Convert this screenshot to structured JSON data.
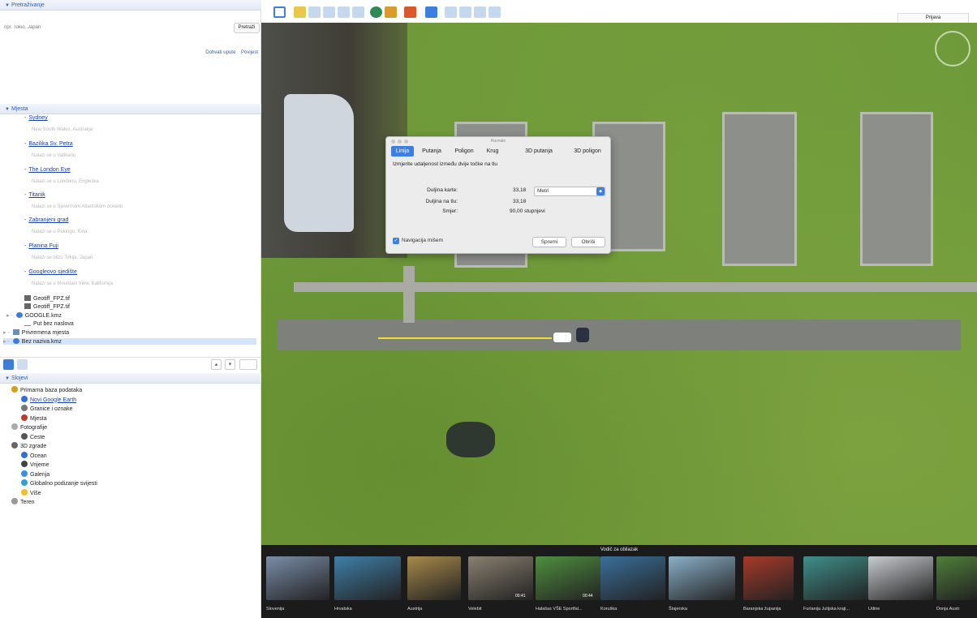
{
  "search": {
    "header": "Pretraživanje",
    "placeholder": "npr. Tokio, Japan",
    "button": "Pretraži",
    "links": [
      "Dohvati upute",
      "Povijest"
    ]
  },
  "places": {
    "header": "Mjesta",
    "items": [
      {
        "title": "Sydney",
        "subtitle": "New South Wales, Australija"
      },
      {
        "title": "Bazilika Sv. Petra",
        "subtitle": "Nalazi se u Vatikanu"
      },
      {
        "title": "The London Eye",
        "subtitle": "Nalazi se u Londonu, Engleska"
      },
      {
        "title": "Titanik",
        "subtitle": "Nalazi se u Sjevernom Atlantskom oceanu"
      },
      {
        "title": "Zabranjeni grad",
        "subtitle": "Nalazi se u Pekingu, Kina"
      },
      {
        "title": "Planina Fuji",
        "subtitle": "Nalazi se blizu Tokija, Japan"
      },
      {
        "title": "Googleovo sjedište",
        "subtitle": "Nalazi se u Mountain View, Kalifornija"
      }
    ],
    "files": [
      "Geotiff_FPZ.tif",
      "Geotiff_FPZ.tif",
      "GOOGLE.kmz",
      "Put bez naslova",
      "Privremena mjesta",
      "Bez naziva.kmz"
    ]
  },
  "layers": {
    "header": "Slojevi",
    "items": [
      {
        "label": "Primarna baza podataka",
        "color": "#d4a017"
      },
      {
        "label": "Novi Google Earth",
        "color": "#2f6fd8",
        "link": true
      },
      {
        "label": "Granice i oznake",
        "color": "#777777"
      },
      {
        "label": "Mjesta",
        "color": "#c0392b"
      },
      {
        "label": "Fotografije",
        "color": "#aaaaaa"
      },
      {
        "label": "Ceste",
        "color": "#555555"
      },
      {
        "label": "3D zgrade",
        "color": "#666666"
      },
      {
        "label": "Ocean",
        "color": "#2f6fd8"
      },
      {
        "label": "Vrijeme",
        "color": "#444444"
      },
      {
        "label": "Galerija",
        "color": "#3a8ee6"
      },
      {
        "label": "Globalno podizanje svijesti",
        "color": "#2f9fd8"
      },
      {
        "label": "Više",
        "color": "#f0c020"
      },
      {
        "label": "Teren",
        "color": "#999999"
      }
    ]
  },
  "toolbar": {
    "signin": "Prijava"
  },
  "ruler": {
    "window_title": "Ravnalo",
    "tabs": [
      "Linija",
      "Putanja",
      "Poligon",
      "Krug",
      "3D putanja",
      "3D poligon"
    ],
    "active_tab": "Linija",
    "instruction": "Izmjerite udaljenost između dvije točke na tlu",
    "map_length_label": "Duljina karte:",
    "map_length_value": "33,18",
    "ground_length_label": "Duljina na tlu:",
    "ground_length_value": "33,18",
    "heading_label": "Smjer:",
    "heading_value": "90,00 stupnjevi",
    "unit": "Metri",
    "nav_mouse": "Navigacija mišem",
    "save": "Spremi",
    "clear": "Obriši"
  },
  "tour": {
    "title": "Vodič za obilazak",
    "items": [
      {
        "label": "Slovenija",
        "duration": ""
      },
      {
        "label": "Hrvatska",
        "duration": ""
      },
      {
        "label": "Austrija",
        "duration": ""
      },
      {
        "label": "Velebit",
        "duration": "00:41"
      },
      {
        "label": "Halašas VŠE Sportfal...",
        "duration": "00:44"
      },
      {
        "label": "Koruška",
        "duration": ""
      },
      {
        "label": "Štajerska",
        "duration": ""
      },
      {
        "label": "Baranjska županija",
        "duration": ""
      },
      {
        "label": "Furlanija Julijska kraji...",
        "duration": ""
      },
      {
        "label": "Udine",
        "duration": ""
      },
      {
        "label": "Donja Austr",
        "duration": ""
      }
    ]
  },
  "colors": {
    "accent": "#3d7fe0",
    "link": "#1a3fa8",
    "grass": "#6f9a3a"
  }
}
